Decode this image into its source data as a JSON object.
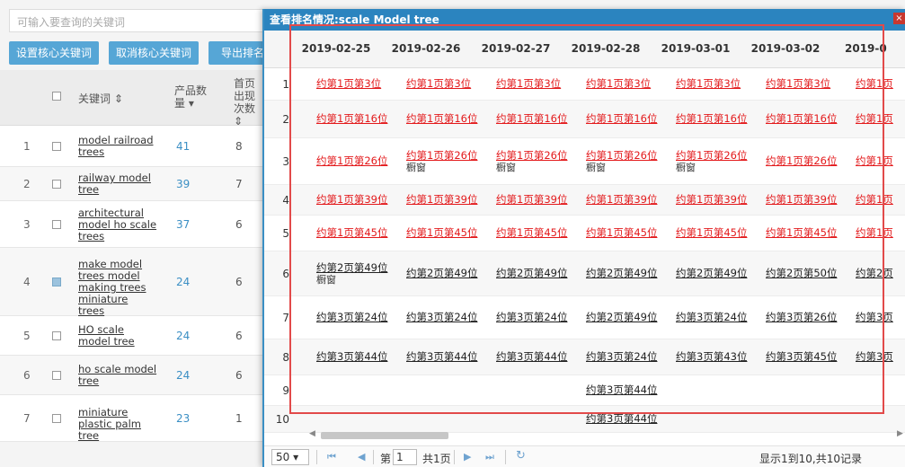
{
  "bg": {
    "search_placeholder": "可输入要查询的关键词",
    "buttons": [
      "设置核心关键词",
      "取消核心关键词",
      "导出排名"
    ],
    "headers": {
      "keyword": "关键词 ⇕",
      "count": "产品数量 ▾",
      "first": "首页出现次数 ⇕"
    },
    "rows": [
      {
        "num": "1",
        "keyword": "model railroad trees",
        "count": "41",
        "top": "8",
        "checked": false
      },
      {
        "num": "2",
        "keyword": "railway model tree",
        "count": "39",
        "top": "7",
        "checked": false
      },
      {
        "num": "3",
        "keyword": "architectural model ho scale trees",
        "count": "37",
        "top": "6",
        "checked": false
      },
      {
        "num": "4",
        "keyword": "make model trees model making trees miniature trees",
        "count": "24",
        "top": "6",
        "checked": true
      },
      {
        "num": "5",
        "keyword": "HO scale model tree",
        "count": "24",
        "top": "6",
        "checked": false
      },
      {
        "num": "6",
        "keyword": "ho scale model tree",
        "count": "24",
        "top": "6",
        "checked": false
      },
      {
        "num": "7",
        "keyword": "miniature plastic palm tree",
        "count": "23",
        "top": "1",
        "checked": false
      }
    ]
  },
  "modal": {
    "title": "查看排名情况:scale Model tree",
    "close": "×",
    "dates": [
      "2019-02-25",
      "2019-02-26",
      "2019-02-27",
      "2019-02-28",
      "2019-03-01",
      "2019-03-02",
      "2019-0"
    ],
    "rows": [
      {
        "idx": "1",
        "cells": [
          {
            "t": "约第1页第3位",
            "c": "red"
          },
          {
            "t": "约第1页第3位",
            "c": "red"
          },
          {
            "t": "约第1页第3位",
            "c": "red"
          },
          {
            "t": "约第1页第3位",
            "c": "red"
          },
          {
            "t": "约第1页第3位",
            "c": "red"
          },
          {
            "t": "约第1页第3位",
            "c": "red"
          },
          {
            "t": "约第1页",
            "c": "red"
          }
        ]
      },
      {
        "idx": "2",
        "cells": [
          {
            "t": "约第1页第16位",
            "c": "red"
          },
          {
            "t": "约第1页第16位",
            "c": "red"
          },
          {
            "t": "约第1页第16位",
            "c": "red"
          },
          {
            "t": "约第1页第16位",
            "c": "red"
          },
          {
            "t": "约第1页第16位",
            "c": "red"
          },
          {
            "t": "约第1页第16位",
            "c": "red"
          },
          {
            "t": "约第1页",
            "c": "red"
          }
        ]
      },
      {
        "idx": "3",
        "cells": [
          {
            "t": "约第1页第26位",
            "c": "red"
          },
          {
            "t": "约第1页第26位",
            "c": "red",
            "sub": "橱窗"
          },
          {
            "t": "约第1页第26位",
            "c": "red",
            "sub": "橱窗"
          },
          {
            "t": "约第1页第26位",
            "c": "red",
            "sub": "橱窗"
          },
          {
            "t": "约第1页第26位",
            "c": "red",
            "sub": "橱窗"
          },
          {
            "t": "约第1页第26位",
            "c": "red"
          },
          {
            "t": "约第1页",
            "c": "red"
          }
        ]
      },
      {
        "idx": "4",
        "cells": [
          {
            "t": "约第1页第39位",
            "c": "red"
          },
          {
            "t": "约第1页第39位",
            "c": "red"
          },
          {
            "t": "约第1页第39位",
            "c": "red"
          },
          {
            "t": "约第1页第39位",
            "c": "red"
          },
          {
            "t": "约第1页第39位",
            "c": "red"
          },
          {
            "t": "约第1页第39位",
            "c": "red"
          },
          {
            "t": "约第1页",
            "c": "red"
          }
        ]
      },
      {
        "idx": "5",
        "cells": [
          {
            "t": "约第1页第45位",
            "c": "red"
          },
          {
            "t": "约第1页第45位",
            "c": "red"
          },
          {
            "t": "约第1页第45位",
            "c": "red"
          },
          {
            "t": "约第1页第45位",
            "c": "red"
          },
          {
            "t": "约第1页第45位",
            "c": "red"
          },
          {
            "t": "约第1页第45位",
            "c": "red"
          },
          {
            "t": "约第1页",
            "c": "red"
          }
        ]
      },
      {
        "idx": "6",
        "cells": [
          {
            "t": "约第2页第49位",
            "c": "black",
            "sub": "橱窗"
          },
          {
            "t": "约第2页第49位",
            "c": "black"
          },
          {
            "t": "约第2页第49位",
            "c": "black"
          },
          {
            "t": "约第2页第49位",
            "c": "black"
          },
          {
            "t": "约第2页第49位",
            "c": "black"
          },
          {
            "t": "约第2页第50位",
            "c": "black"
          },
          {
            "t": "约第2页",
            "c": "black"
          }
        ]
      },
      {
        "idx": "7",
        "cells": [
          {
            "t": "约第3页第24位",
            "c": "black"
          },
          {
            "t": "约第3页第24位",
            "c": "black"
          },
          {
            "t": "约第3页第24位",
            "c": "black"
          },
          {
            "t": "约第2页第49位",
            "c": "black"
          },
          {
            "t": "约第3页第24位",
            "c": "black"
          },
          {
            "t": "约第3页第26位",
            "c": "black"
          },
          {
            "t": "约第3页",
            "c": "black"
          }
        ]
      },
      {
        "idx": "8",
        "cells": [
          {
            "t": "约第3页第44位",
            "c": "black"
          },
          {
            "t": "约第3页第44位",
            "c": "black"
          },
          {
            "t": "约第3页第44位",
            "c": "black"
          },
          {
            "t": "约第3页第24位",
            "c": "black"
          },
          {
            "t": "约第3页第43位",
            "c": "black"
          },
          {
            "t": "约第3页第45位",
            "c": "black"
          },
          {
            "t": "约第3页",
            "c": "black"
          }
        ]
      },
      {
        "idx": "9",
        "cells": [
          {
            "t": "",
            "c": "black"
          },
          {
            "t": "",
            "c": "black"
          },
          {
            "t": "",
            "c": "black"
          },
          {
            "t": "约第3页第44位",
            "c": "black"
          },
          {
            "t": "",
            "c": "black"
          },
          {
            "t": "",
            "c": "black"
          },
          {
            "t": "",
            "c": "black"
          }
        ]
      },
      {
        "idx": "10",
        "cells": [
          {
            "t": "",
            "c": "black"
          },
          {
            "t": "",
            "c": "black"
          },
          {
            "t": "",
            "c": "black"
          },
          {
            "t": "约第3页第44位",
            "c": "black"
          },
          {
            "t": "",
            "c": "black"
          },
          {
            "t": "",
            "c": "black"
          },
          {
            "t": "",
            "c": "black"
          }
        ]
      }
    ],
    "pager": {
      "page_size": "50 ▾",
      "first": "⏮",
      "prev": "◀",
      "page_label": "第",
      "page_value": "1",
      "total": "共1页",
      "next": "▶",
      "last": "⏭",
      "refresh": "↻",
      "info": "显示1到10,共10记录"
    },
    "scroll": {
      "left": "◀",
      "right": "▶"
    }
  },
  "colors": {
    "accent": "#2b84bf",
    "red_text": "#e3191b",
    "highlight": "#e24a4a"
  }
}
